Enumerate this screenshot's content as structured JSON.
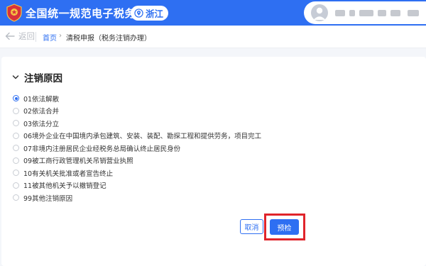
{
  "header": {
    "app_title": "全国统一规范电子税务局",
    "region": "浙江",
    "logo_icon": "tax-bureau-emblem",
    "region_icon": "location-pin-icon",
    "accent_color": "#2e6ff2"
  },
  "breadcrumb": {
    "back_label": "返回",
    "home": "首页",
    "separator": "›",
    "current": "清税申报（税务注销办理）"
  },
  "section": {
    "title": "注销原因",
    "options": [
      {
        "label": "01依法解散",
        "checked": true
      },
      {
        "label": "02依法合并",
        "checked": false
      },
      {
        "label": "03依法分立",
        "checked": false
      },
      {
        "label": "06境外企业在中国境内承包建筑、安装、装配、勘探工程和提供劳务，项目完工",
        "checked": false
      },
      {
        "label": "07非境内注册居民企业经税务总局确认终止居民身份",
        "checked": false
      },
      {
        "label": "09被工商行政管理机关吊销营业执照",
        "checked": false
      },
      {
        "label": "10有关机关批准或者宣告终止",
        "checked": false
      },
      {
        "label": "11被其他机关予以撤销登记",
        "checked": false
      },
      {
        "label": "99其他注销原因",
        "checked": false
      }
    ]
  },
  "actions": {
    "cancel_label": "取消",
    "precheck_label": "预检",
    "highlight_color": "#e0242b"
  }
}
